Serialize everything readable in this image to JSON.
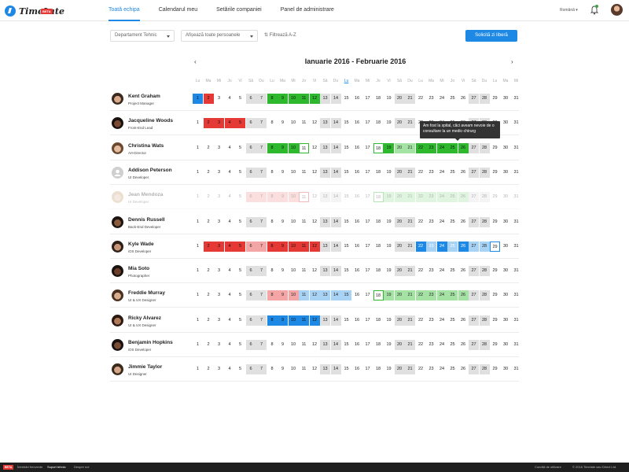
{
  "app": {
    "name": "TimeLate",
    "badge": "BETA"
  },
  "nav": {
    "tabs": [
      "Toată echipa",
      "Calendarul meu",
      "Setările companiei",
      "Panel de administrare"
    ],
    "active": 0
  },
  "header": {
    "language": "Română"
  },
  "filters": {
    "department": "Departament Tehnic",
    "people": "Afișează toate persoanele",
    "sort": "Filtrează A-Z",
    "request_button": "Solicită zi liberă"
  },
  "calendar": {
    "title": "Ianuarie 2016 - Februarie 2016",
    "weekday_letters": [
      "Lu",
      "Ma",
      "Mi",
      "Jo",
      "Vi",
      "Sâ",
      "Du"
    ],
    "days": [
      1,
      2,
      3,
      4,
      5,
      6,
      7,
      8,
      9,
      10,
      11,
      12,
      13,
      14,
      15,
      16,
      17,
      18,
      19,
      20,
      21,
      22,
      23,
      24,
      25,
      26,
      27,
      28,
      29,
      30,
      31
    ],
    "today_index": 14
  },
  "colors": {
    "blue": "#1e88e5",
    "red": "#e53935",
    "green": "#2db82d",
    "light_green": "#a5e3a5",
    "light_red": "#f4a6a6",
    "light_blue": "#a9d3f5",
    "weekend": "#e0e0e0"
  },
  "employees": [
    {
      "name": "Kent Graham",
      "role": "Project Manager",
      "dim": false
    },
    {
      "name": "Jacqueline Woods",
      "role": "Front-End Lead",
      "dim": false
    },
    {
      "name": "Christina Wats",
      "role": "Art-Director",
      "dim": false
    },
    {
      "name": "Addison Peterson",
      "role": "UI Developer",
      "dim": false
    },
    {
      "name": "Jean Mendoza",
      "role": "UI Developer",
      "dim": true
    },
    {
      "name": "Dennis Russell",
      "role": "Back-End Developer",
      "dim": false
    },
    {
      "name": "Kyle Wade",
      "role": "iOS Developer",
      "dim": false
    },
    {
      "name": "Mia Soto",
      "role": "Photographer",
      "dim": false
    },
    {
      "name": "Freddie Murray",
      "role": "UI & UX Designer",
      "dim": false
    },
    {
      "name": "Ricky Alvarez",
      "role": "UI & UX Designer",
      "dim": false
    },
    {
      "name": "Benjamin Hopkins",
      "role": "iOS Developer",
      "dim": false
    },
    {
      "name": "Jimmie Taylor",
      "role": "UI Designer",
      "dim": false
    }
  ],
  "absences": [
    [
      [
        1,
        1,
        "blue"
      ],
      [
        2,
        2,
        "red"
      ],
      [
        8,
        12,
        "green"
      ]
    ],
    [
      [
        2,
        5,
        "red"
      ]
    ],
    [
      [
        8,
        10,
        "green"
      ],
      [
        11,
        11,
        "outline-green"
      ],
      [
        18,
        18,
        "outline-green"
      ],
      [
        19,
        19,
        "green"
      ],
      [
        20,
        21,
        "light_green"
      ],
      [
        22,
        26,
        "green"
      ]
    ],
    [],
    [
      [
        6,
        7,
        "light_red"
      ],
      [
        8,
        10,
        "light_red"
      ],
      [
        11,
        11,
        "outline-red"
      ],
      [
        18,
        18,
        "outline-green"
      ],
      [
        19,
        19,
        "light_green"
      ],
      [
        20,
        21,
        "light_green"
      ],
      [
        22,
        26,
        "light_green"
      ]
    ],
    [],
    [
      [
        2,
        12,
        "red"
      ],
      [
        6,
        7,
        "light_red"
      ],
      [
        22,
        28,
        "stripe-blue"
      ],
      [
        27,
        28,
        "light_blue"
      ],
      [
        29,
        29,
        "outline-blue"
      ]
    ],
    [],
    [
      [
        8,
        10,
        "light_red"
      ],
      [
        11,
        12,
        "light_blue"
      ],
      [
        13,
        15,
        "light_blue"
      ],
      [
        18,
        18,
        "outline-green"
      ],
      [
        19,
        19,
        "light_green"
      ],
      [
        20,
        26,
        "light_green"
      ]
    ],
    [
      [
        8,
        12,
        "blue"
      ]
    ],
    [],
    []
  ],
  "tooltip": {
    "text": "Am fost la spital, căci aveam nevoie de o consultare la un medic-chirurg"
  },
  "footer": {
    "badge": "BETA",
    "links": [
      "Întrebări frecvente",
      "Suport tehnic",
      "Despre noi"
    ],
    "terms": "Condiții de utilizare",
    "copyright": "© 2016 Timelate sau Direct Ltd."
  }
}
